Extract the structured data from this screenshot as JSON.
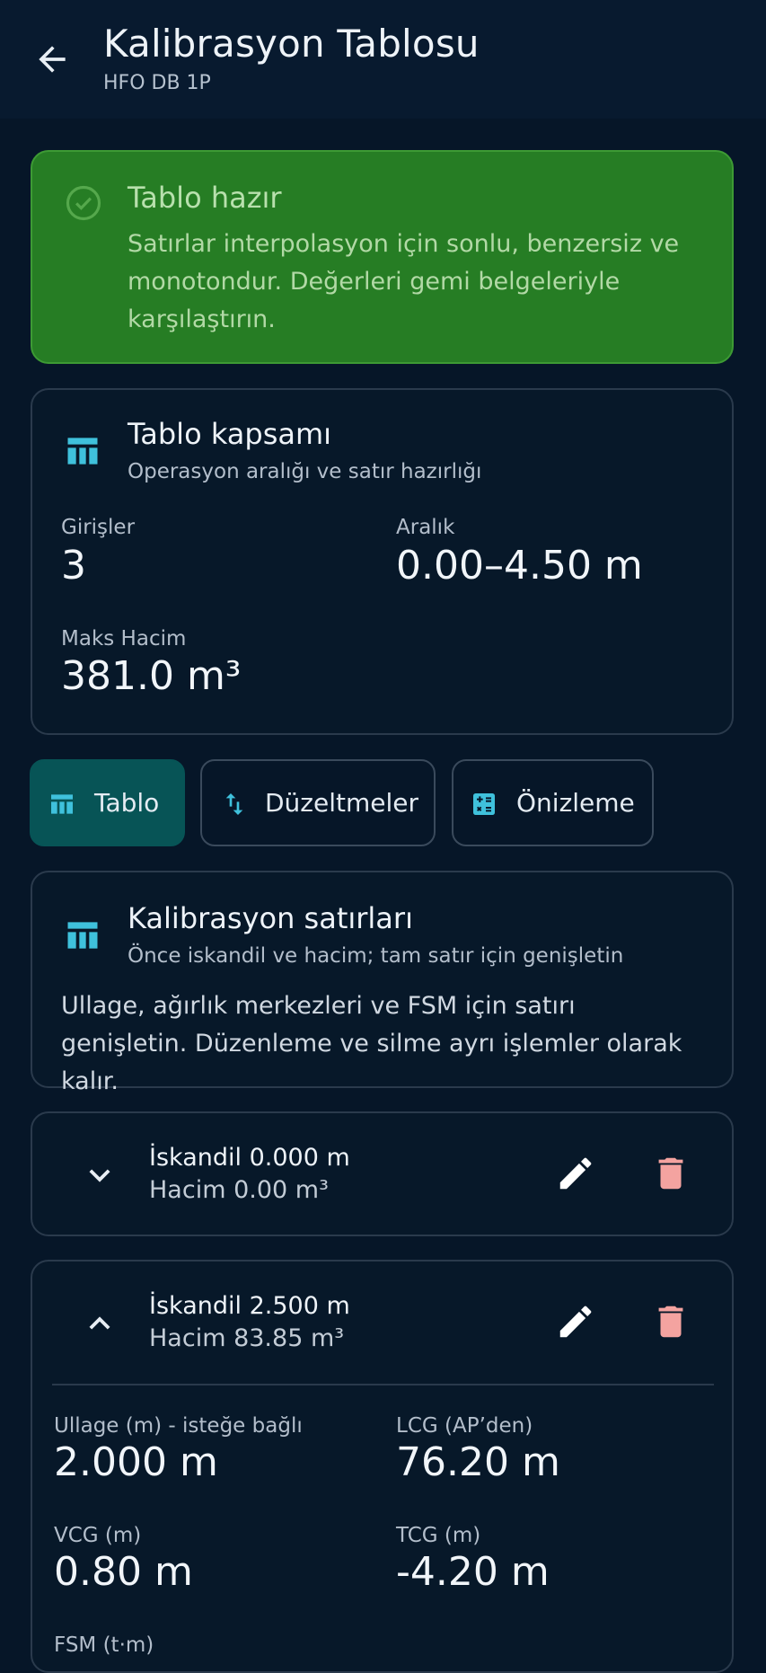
{
  "header": {
    "title": "Kalibrasyon Tablosu",
    "subtitle": "HFO DB 1P"
  },
  "status": {
    "title": "Tablo hazır",
    "body": "Satırlar interpolasyon için sonlu, benzersiz ve monotondur. Değerleri gemi belgeleriyle karşılaştırın."
  },
  "coverage": {
    "title": "Tablo kapsamı",
    "subtitle": "Operasyon aralığı ve satır hazırlığı",
    "entries_label": "Girişler",
    "entries_value": "3",
    "range_label": "Aralık",
    "range_value": "0.00–4.50 m",
    "maxvol_label": "Maks Hacim",
    "maxvol_value": "381.0 m³"
  },
  "tabs": [
    {
      "label": "Tablo",
      "icon": "table-icon",
      "active": true
    },
    {
      "label": "Düzeltmeler",
      "icon": "swap-vert-icon",
      "active": false
    },
    {
      "label": "Önizleme",
      "icon": "calculate-icon",
      "active": false
    }
  ],
  "rows_card": {
    "title": "Kalibrasyon satırları",
    "subtitle": "Önce iskandil ve hacim; tam satır için genişletin",
    "body": "Ullage, ağırlık merkezleri ve FSM için satırı genişletin. Düzenleme ve silme ayrı işlemler olarak kalır."
  },
  "rows": [
    {
      "sounding": "İskandil 0.000 m",
      "volume": "Hacim 0.00 m³",
      "expanded": false
    },
    {
      "sounding": "İskandil 2.500 m",
      "volume": "Hacim 83.85 m³",
      "expanded": true,
      "ullage_label": "Ullage (m) - isteğe bağlı",
      "ullage_value": "2.000 m",
      "lcg_label": "LCG (AP’den)",
      "lcg_value": "76.20 m",
      "vcg_label": "VCG (m)",
      "vcg_value": "0.80 m",
      "tcg_label": "TCG (m)",
      "tcg_value": "-4.20 m",
      "fsm_label": "FSM (t·m)"
    }
  ],
  "colors": {
    "accent": "#3fc1dc",
    "success": "#267d24",
    "danger": "#f4a3a0",
    "active_tab": "#075456"
  }
}
